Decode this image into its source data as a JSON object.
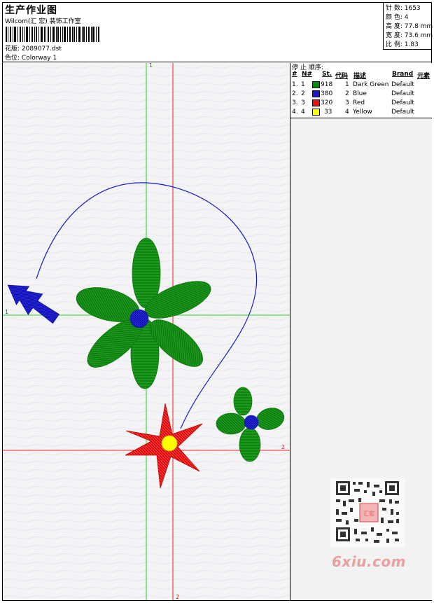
{
  "header": {
    "title": "生产作业图",
    "studio": "Wilcom(汇 宏) 装饰工作室",
    "design_label": "花版:",
    "design_file": "2089077.dst",
    "colorway_label": "色位:",
    "colorway": "Colorway 1"
  },
  "stats": {
    "stitches": "针 数: 1653",
    "colors": "颜 色: 4",
    "height": "高 度: 77.8 mm",
    "width": "宽 度: 73.6 mm",
    "scale": "比 例: 1.83"
  },
  "stop_sequence": {
    "title": "停 止 顺序:",
    "headers": [
      "#",
      "N#",
      "St.",
      "代码",
      "描述",
      "Brand",
      "元素"
    ],
    "rows": [
      {
        "num": "1.",
        "n": "1",
        "color": "#008f00",
        "stitches": "918",
        "code": "1",
        "description": "Dark Green",
        "brand": "Default"
      },
      {
        "num": "2.",
        "n": "2",
        "color": "#1a1acc",
        "stitches": "380",
        "code": "2",
        "description": "Blue",
        "brand": "Default"
      },
      {
        "num": "3.",
        "n": "3",
        "color": "#ee1111",
        "stitches": "320",
        "code": "3",
        "description": "Red",
        "brand": "Default"
      },
      {
        "num": "4.",
        "n": "4",
        "color": "#ffff00",
        "stitches": "33",
        "code": "4",
        "description": "Yellow",
        "brand": "Default"
      }
    ]
  },
  "guides": {
    "green_top": "1",
    "green_left": "1",
    "red_right": "2",
    "red_bottom": "2"
  },
  "watermark": "6xiu.com",
  "seal_text": "汇宏"
}
